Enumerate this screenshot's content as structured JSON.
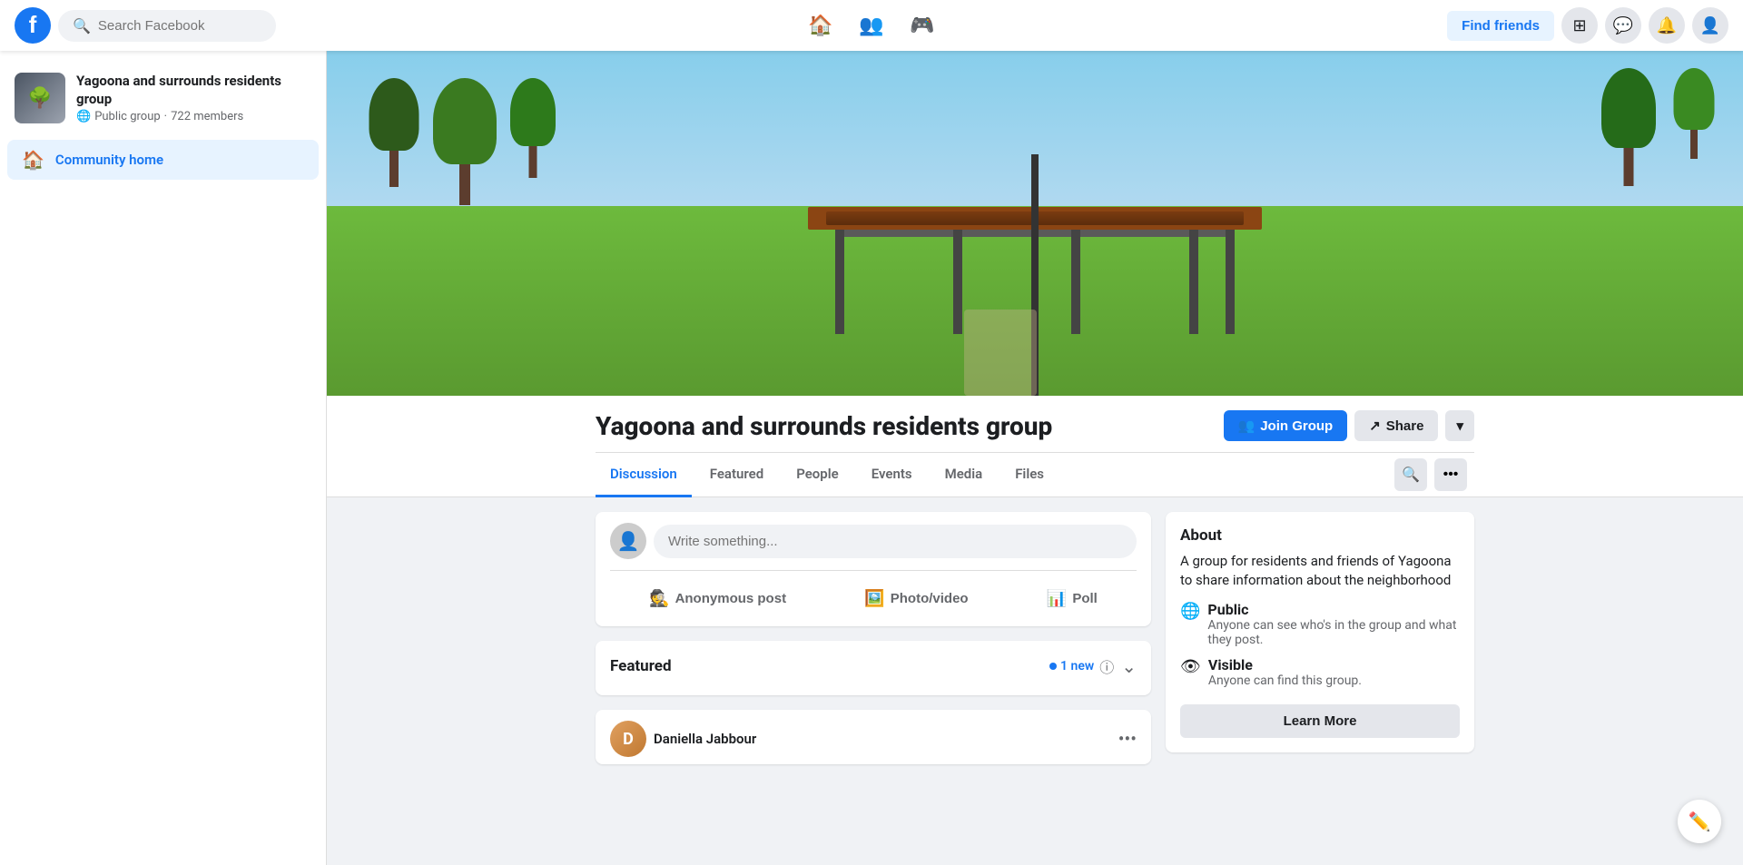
{
  "app": {
    "name": "Facebook"
  },
  "topnav": {
    "search_placeholder": "Search Facebook",
    "find_friends_label": "Find friends",
    "home_icon": "🏠",
    "friends_icon": "👥",
    "profile_menu_icon": "😊"
  },
  "sidebar": {
    "group_name": "Yagoona and surrounds residents group",
    "group_type": "Public group",
    "member_count": "722 members",
    "nav_items": [
      {
        "label": "Community home",
        "active": true
      }
    ]
  },
  "group": {
    "title": "Yagoona and surrounds residents group",
    "join_label": "Join Group",
    "share_label": "Share",
    "tabs": [
      {
        "label": "Discussion",
        "active": true
      },
      {
        "label": "Featured"
      },
      {
        "label": "People"
      },
      {
        "label": "Events"
      },
      {
        "label": "Media"
      },
      {
        "label": "Files"
      }
    ]
  },
  "write_post": {
    "placeholder": "Write something...",
    "action_anonymous": "Anonymous post",
    "action_photo": "Photo/video",
    "action_poll": "Poll"
  },
  "featured": {
    "title": "Featured",
    "new_count": "1 new"
  },
  "post_preview": {
    "poster_name": "Daniella Jabbour",
    "poster_initial": "D"
  },
  "about": {
    "title": "About",
    "description": "A group for residents and friends of Yagoona to share information about the neighborhood",
    "privacy_label": "Public",
    "privacy_desc": "Anyone can see who's in the group and what they post.",
    "visible_label": "Visible",
    "visible_desc": "Anyone can find this group.",
    "learn_more_label": "Learn More"
  }
}
